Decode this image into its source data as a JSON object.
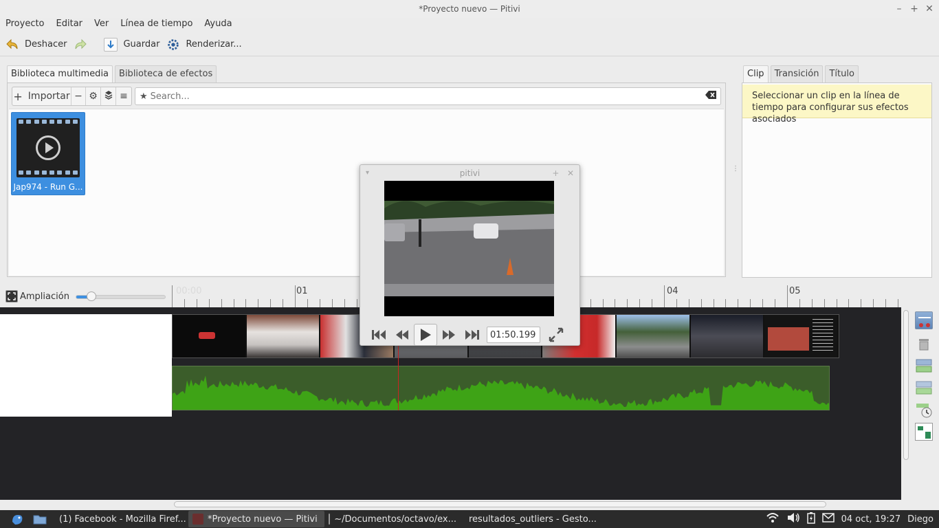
{
  "window": {
    "title": "*Proyecto nuevo — Pitivi"
  },
  "menu": [
    "Proyecto",
    "Editar",
    "Ver",
    "Línea de tiempo",
    "Ayuda"
  ],
  "toolbar": {
    "undo": "Deshacer",
    "save": "Guardar",
    "render": "Renderizar..."
  },
  "library": {
    "tabs": [
      "Biblioteca multimedia",
      "Biblioteca de efectos"
    ],
    "import_label": "Importar",
    "search_placeholder": "Search...",
    "clip_name": "Jap974 - Run G..."
  },
  "right_panel": {
    "tabs": [
      "Clip",
      "Transición",
      "Título"
    ],
    "info": "Seleccionar un clip en la línea de tiempo para configurar sus efectos asociados"
  },
  "zoom": {
    "label": "Ampliación",
    "level": 0.17
  },
  "ruler": {
    "ticks": [
      "01",
      "04",
      "05"
    ]
  },
  "viewer": {
    "title": "pitivi",
    "timecode": "01:50.199"
  },
  "taskbar": {
    "tasks": [
      "(1) Facebook - Mozilla Firef...",
      "*Proyecto nuevo — Pitivi",
      "~/Documentos/octavo/ex...",
      "resultados_outliers - Gesto..."
    ],
    "clock": "04 oct, 19:27",
    "user": "Diego"
  },
  "colors": {
    "accent": "#3d8fe0",
    "waveform": "#3ea316",
    "playhead": "#cc2222",
    "info_bg": "#fcf7c6"
  }
}
